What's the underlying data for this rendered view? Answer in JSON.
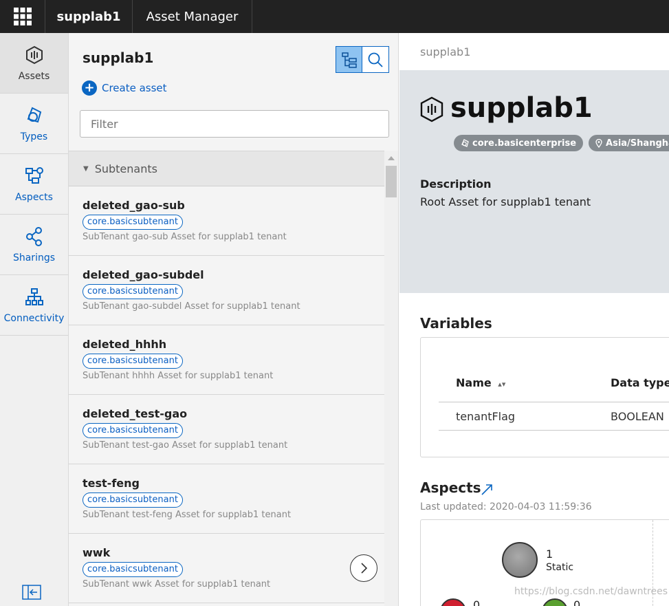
{
  "topbar": {
    "tenant": "supplab1",
    "app": "Asset Manager",
    "launcher_icon": "app-grid-icon"
  },
  "nav": {
    "items": [
      {
        "label": "Assets",
        "icon": "asset-icon",
        "active": true
      },
      {
        "label": "Types",
        "icon": "types-icon"
      },
      {
        "label": "Aspects",
        "icon": "aspects-icon"
      },
      {
        "label": "Sharings",
        "icon": "share-icon"
      },
      {
        "label": "Connectivity",
        "icon": "connectivity-icon"
      }
    ],
    "collapse_icon": "collapse-sidebar-icon"
  },
  "list_panel": {
    "title": "supplab1",
    "create_label": "Create asset",
    "filter_placeholder": "Filter",
    "group_label": "Subtenants",
    "items": [
      {
        "name": "deleted_gao-sub",
        "type": "core.basicsubtenant",
        "desc": "SubTenant gao-sub Asset for supplab1 tenant"
      },
      {
        "name": "deleted_gao-subdel",
        "type": "core.basicsubtenant",
        "desc": "SubTenant gao-subdel Asset for supplab1 tenant"
      },
      {
        "name": "deleted_hhhh",
        "type": "core.basicsubtenant",
        "desc": "SubTenant hhhh Asset for supplab1 tenant"
      },
      {
        "name": "deleted_test-gao",
        "type": "core.basicsubtenant",
        "desc": "SubTenant test-gao Asset for supplab1 tenant"
      },
      {
        "name": "test-feng",
        "type": "core.basicsubtenant",
        "desc": "SubTenant test-feng Asset for supplab1 tenant"
      },
      {
        "name": "wwk",
        "type": "core.basicsubtenant",
        "desc": "SubTenant wwk Asset for supplab1 tenant"
      }
    ]
  },
  "detail": {
    "breadcrumb": "supplab1",
    "title": "supplab1",
    "chips": [
      {
        "label": "core.basicenterprise",
        "icon": "type-icon"
      },
      {
        "label": "Asia/Shanghai",
        "icon": "location-pin-icon"
      }
    ],
    "description_label": "Description",
    "description": "Root Asset for supplab1 tenant",
    "variables": {
      "title": "Variables",
      "columns": [
        "Name",
        "Data type"
      ],
      "rows": [
        [
          "tenantFlag",
          "BOOLEAN"
        ]
      ]
    },
    "aspects": {
      "title": "Aspects",
      "last_updated": "Last updated: 2020-04-03 11:59:36",
      "static_count": "1",
      "static_label": "Static",
      "red_count": "0",
      "green_count": "0"
    }
  },
  "watermark": "https://blog.csdn.net/dawntrees",
  "colors": {
    "accent": "#0a66c2",
    "topbar": "#222222",
    "hero": "#dfe3e7"
  }
}
